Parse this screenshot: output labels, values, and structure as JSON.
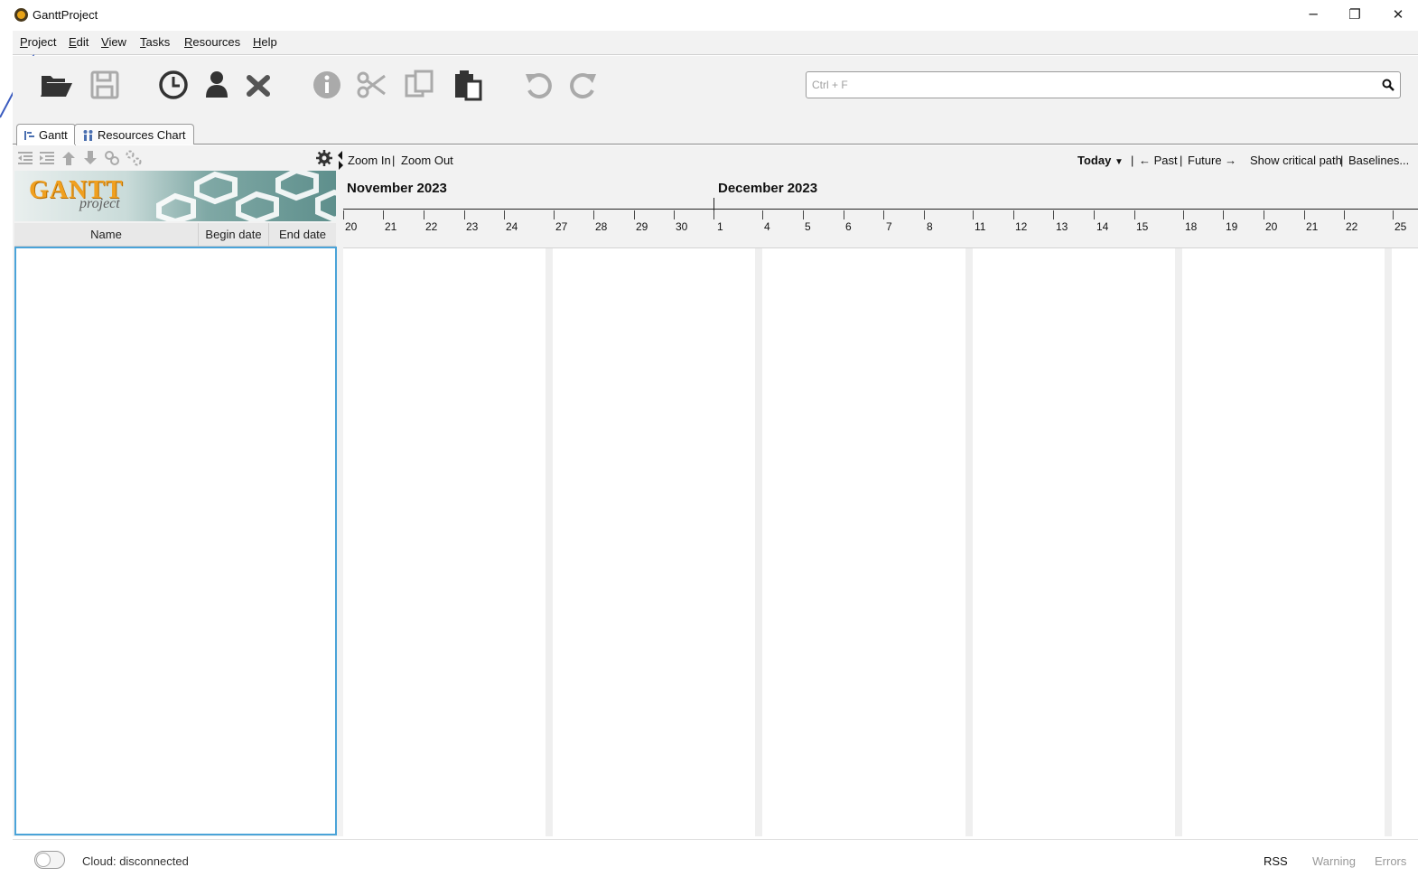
{
  "window": {
    "title": "GanttProject",
    "minimize_glyph": "─",
    "restore_glyph": "❐",
    "close_glyph": "✕"
  },
  "menu": {
    "items": [
      {
        "label": "Project"
      },
      {
        "label": "Edit"
      },
      {
        "label": "View"
      },
      {
        "label": "Tasks"
      },
      {
        "label": "Resources"
      },
      {
        "label": "Help"
      }
    ]
  },
  "toolbar": {
    "buttons": [
      "open-folder-icon",
      "save-icon",
      "clock-icon",
      "person-icon",
      "delete-icon",
      "info-icon",
      "cut-icon",
      "copy-icon",
      "paste-icon",
      "undo-icon",
      "redo-icon"
    ],
    "search_placeholder": "Ctrl + F"
  },
  "tabs": [
    {
      "label": "Gantt",
      "icon": "gantt-icon",
      "active": true
    },
    {
      "label": "Resources Chart",
      "icon": "resources-icon",
      "active": false
    }
  ],
  "tree": {
    "banner_logo": "GANTT",
    "banner_sub": "project",
    "columns": [
      "Name",
      "Begin date",
      "End date"
    ],
    "tools": [
      "outdent-icon",
      "indent-icon",
      "move-up-icon",
      "move-down-icon",
      "link-icon",
      "unlink-icon"
    ]
  },
  "chart": {
    "zoom_in": "Zoom In",
    "zoom_out": "Zoom Out",
    "separator": "|",
    "today": "Today",
    "past": "← Past",
    "future": "Future →",
    "critical_path": "Show critical path",
    "baselines": "Baselines...",
    "months": [
      "November 2023",
      "December 2023"
    ],
    "days": [
      "20",
      "21",
      "22",
      "23",
      "24",
      "27",
      "28",
      "29",
      "30",
      "1",
      "4",
      "5",
      "6",
      "7",
      "8",
      "11",
      "12",
      "13",
      "14",
      "15",
      "18",
      "19",
      "20",
      "21",
      "22",
      "25"
    ]
  },
  "status": {
    "cloud": "Cloud: disconnected",
    "rss": "RSS",
    "warning": "Warning",
    "errors": "Errors"
  },
  "colors": {
    "accent_blue": "#4aa3d8",
    "toolbar_bg": "#f2f2f2",
    "logo_orange": "#f0a020"
  }
}
